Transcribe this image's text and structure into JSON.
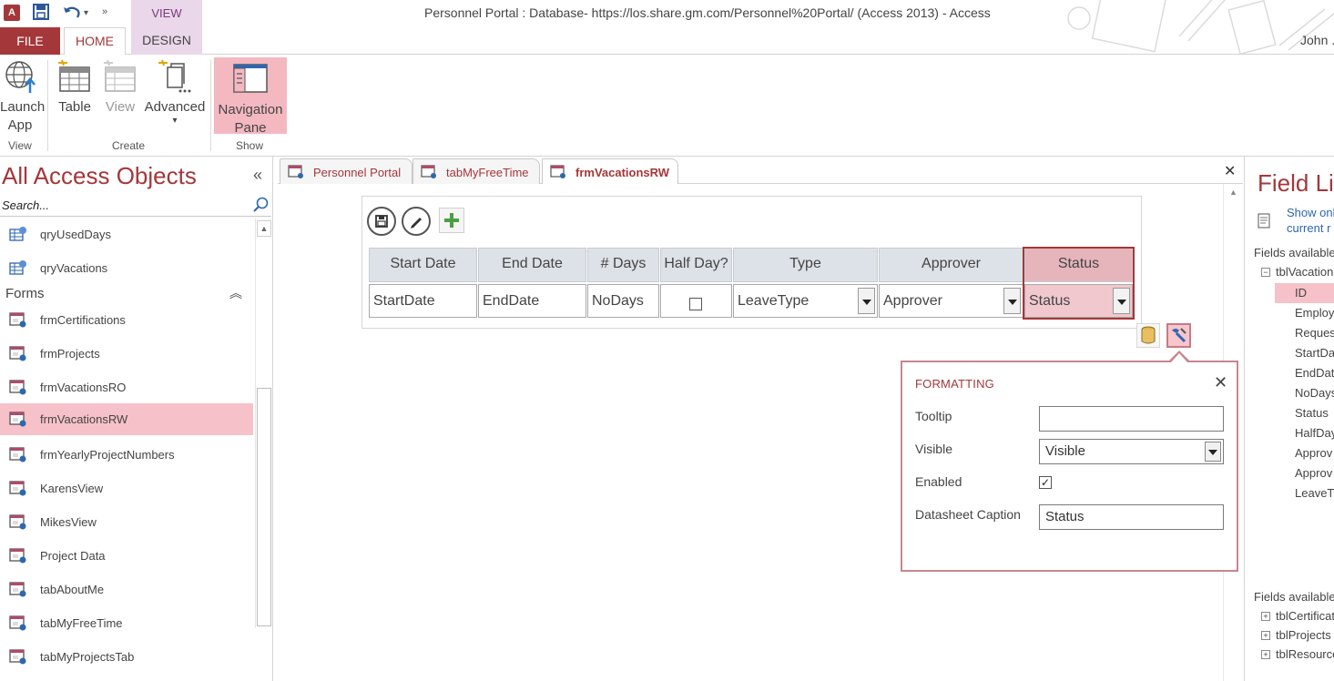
{
  "window": {
    "app_icon": "A",
    "title": "Personnel Portal : Database- https://los.share.gm.com/Personnel%20Portal/ (Access 2013) - Access",
    "context_tab": "VIEW",
    "user": "John ."
  },
  "ribbon_tabs": {
    "file": "FILE",
    "home": "HOME",
    "design": "DESIGN"
  },
  "ribbon": {
    "launch_app": "Launch App",
    "table": "Table",
    "view": "View",
    "advanced": "Advanced",
    "navigation_pane": "Navigation Pane",
    "groups": {
      "view": "View",
      "create": "Create",
      "show": "Show"
    }
  },
  "nav": {
    "title": "All Access Objects",
    "search_placeholder": "Search...",
    "queries": [
      {
        "label": "qryUsedDays"
      },
      {
        "label": "qryVacations"
      }
    ],
    "forms_header": "Forms",
    "forms": [
      {
        "label": "frmCertifications"
      },
      {
        "label": "frmProjects"
      },
      {
        "label": "frmVacationsRO"
      },
      {
        "label": "frmVacationsRW",
        "selected": true
      },
      {
        "label": "frmYearlyProjectNumbers"
      },
      {
        "label": "KarensView"
      },
      {
        "label": "MikesView"
      },
      {
        "label": "Project Data"
      },
      {
        "label": "tabAboutMe"
      },
      {
        "label": "tabMyFreeTime"
      },
      {
        "label": "tabMyProjectsTab"
      }
    ]
  },
  "doc_tabs": [
    {
      "label": "Personnel Portal"
    },
    {
      "label": "tabMyFreeTime"
    },
    {
      "label": "frmVacationsRW",
      "active": true
    }
  ],
  "form": {
    "columns": [
      {
        "header": "Start Date",
        "value": "StartDate"
      },
      {
        "header": "End Date",
        "value": "EndDate"
      },
      {
        "header": "# Days",
        "value": "NoDays"
      },
      {
        "header": "Half Day?",
        "value": ""
      },
      {
        "header": "Type",
        "value": "LeaveType"
      },
      {
        "header": "Approver",
        "value": "Approver"
      },
      {
        "header": "Status",
        "value": "Status"
      }
    ]
  },
  "formatting": {
    "title": "FORMATTING",
    "tooltip_label": "Tooltip",
    "tooltip_value": "",
    "visible_label": "Visible",
    "visible_value": "Visible",
    "enabled_label": "Enabled",
    "enabled_checked": true,
    "caption_label": "Datasheet Caption",
    "caption_value": "Status"
  },
  "field_list": {
    "title": "Field Lis",
    "show_only_line1": "Show onl",
    "show_only_line2": "current r",
    "available_header": "Fields available",
    "table_name": "tblVacation",
    "fields": [
      {
        "label": "ID",
        "selected": true
      },
      {
        "label": "Employ"
      },
      {
        "label": "Request"
      },
      {
        "label": "StartDat"
      },
      {
        "label": "EndDate"
      },
      {
        "label": "NoDays"
      },
      {
        "label": "Status"
      },
      {
        "label": "HalfDay"
      },
      {
        "label": "Approv"
      },
      {
        "label": "Approv"
      },
      {
        "label": "LeaveTy"
      }
    ],
    "other_header": "Fields available",
    "other_tables": [
      {
        "label": "tblCertificat"
      },
      {
        "label": "tblProjects"
      },
      {
        "label": "tblResource"
      }
    ]
  },
  "colors": {
    "accent": "#a4373a",
    "selection": "#f6c1c8",
    "header_gray": "#dde2e8"
  }
}
